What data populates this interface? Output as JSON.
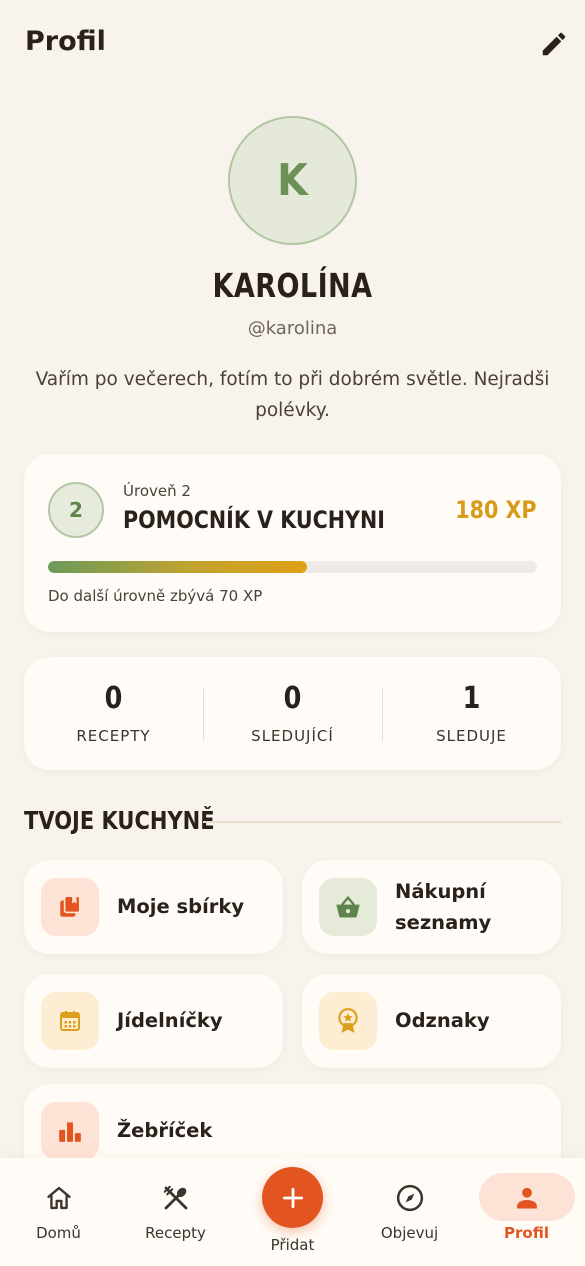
{
  "header": {
    "title": "Profil",
    "edit_icon": "pencil-icon"
  },
  "profile": {
    "avatar_initial": "K",
    "name": "KAROLÍNA",
    "username": "@karolina",
    "bio": "Vařím po večerech, fotím to při dobrém světle. Nejradši polévky."
  },
  "level": {
    "number": "2",
    "label": "Úroveň 2",
    "title": "POMOCNÍK V KUCHYNI",
    "xp": "180 XP",
    "progress_fraction": 0.53,
    "progress_text": "Do další úrovně zbývá 70 XP"
  },
  "stats": [
    {
      "value": "0",
      "label": "RECEPTY"
    },
    {
      "value": "0",
      "label": "SLEDUJÍCÍ"
    },
    {
      "value": "1",
      "label": "SLEDUJE"
    }
  ],
  "section": {
    "title": "TVOJE KUCHYNĚ"
  },
  "tiles": [
    {
      "label": "Moje sbírky",
      "icon": "collections-icon"
    },
    {
      "label": "Nákupní seznamy",
      "line1": "Nákupní",
      "line2": "seznamy",
      "icon": "basket-icon"
    },
    {
      "label": "Jídelníčky",
      "icon": "calendar-icon"
    },
    {
      "label": "Odznaky",
      "icon": "badge-icon"
    },
    {
      "label": "Žebříček",
      "icon": "leaderboard-icon"
    }
  ],
  "nav": [
    {
      "label": "Domů",
      "icon": "home-icon"
    },
    {
      "label": "Recepty",
      "icon": "utensils-icon"
    },
    {
      "label": "Přidat",
      "icon": "plus-icon"
    },
    {
      "label": "Objevuj",
      "icon": "compass-icon"
    },
    {
      "label": "Profil",
      "icon": "person-icon",
      "active": true
    }
  ],
  "colors": {
    "background": "#f8f3ec",
    "accent": "#e35520",
    "xp": "#d89a19",
    "green": "#6c9156"
  }
}
